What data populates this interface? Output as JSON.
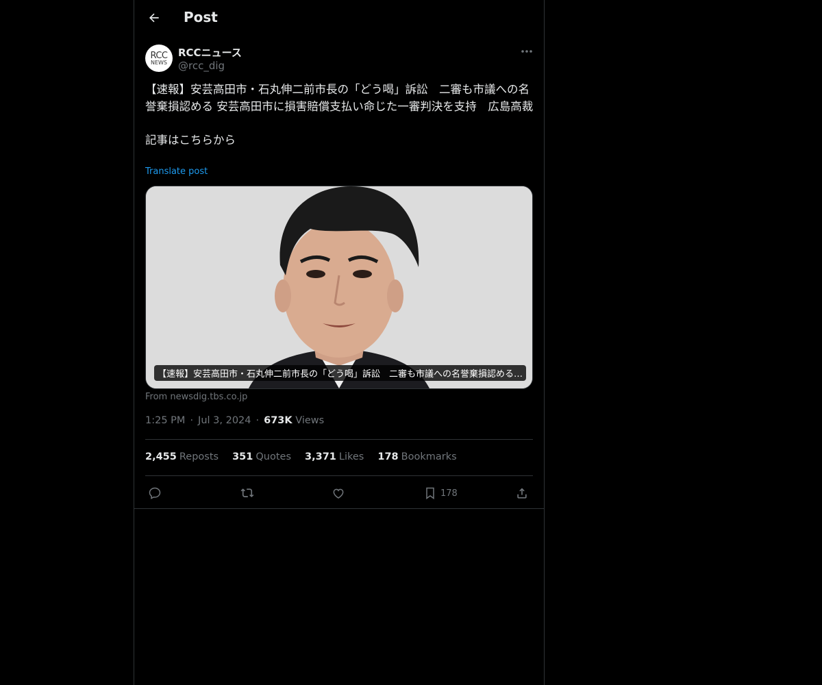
{
  "header": {
    "title": "Post",
    "back_icon": "arrow-left-icon"
  },
  "author": {
    "avatar_line1": "RCC",
    "avatar_line2": "NEWS",
    "display_name": "RCCニュース",
    "handle": "@rcc_dig"
  },
  "tweet": {
    "text": "【速報】安芸高田市・石丸伸二前市長の「どう喝」訴訟　二審も市議への名誉棄損認める 安芸高田市に損害賠償支払い命じた一審判決を支持　広島高裁\n\n記事はこちらから",
    "translate_label": "Translate post"
  },
  "card": {
    "caption": "【速報】安芸高田市・石丸伸二前市長の「どう喝」訴訟　二審も市議への名誉棄損認める…",
    "source": "From newsdig.tbs.co.jp"
  },
  "meta": {
    "time": "1:25 PM",
    "date": "Jul 3, 2024",
    "views_count": "673K",
    "views_label": "Views"
  },
  "stats": {
    "reposts_count": "2,455",
    "reposts_label": "Reposts",
    "quotes_count": "351",
    "quotes_label": "Quotes",
    "likes_count": "3,371",
    "likes_label": "Likes",
    "bookmarks_count": "178",
    "bookmarks_label": "Bookmarks"
  },
  "actions": {
    "bookmark_count": "178"
  },
  "colors": {
    "background": "#000000",
    "text": "#e7e9ea",
    "muted": "#71767b",
    "link": "#1d9bf0",
    "border": "#2f3336"
  }
}
